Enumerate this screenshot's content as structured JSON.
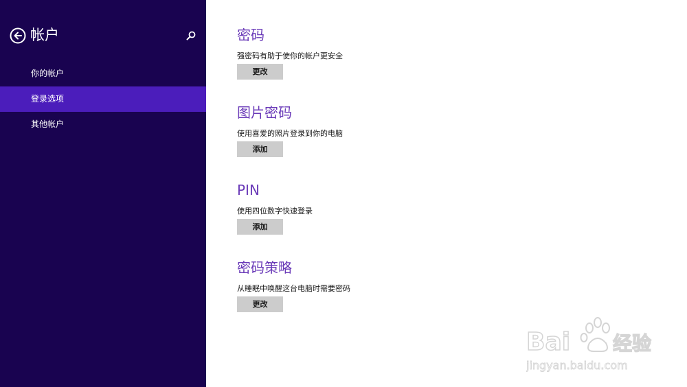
{
  "sidebar": {
    "title": "帐户",
    "back_icon": "back-arrow-circle-icon",
    "search_icon": "search-icon",
    "background": "#190350",
    "selected_color": "#4b1dbb",
    "items": [
      {
        "label": "你的帐户",
        "selected": false
      },
      {
        "label": "登录选项",
        "selected": true
      },
      {
        "label": "其他帐户",
        "selected": false
      }
    ]
  },
  "main": {
    "accent_color": "#6a3ab8",
    "sections": [
      {
        "title": "密码",
        "description": "强密码有助于使你的帐户更安全",
        "button_label": "更改"
      },
      {
        "title": "图片密码",
        "description": "使用喜爱的照片登录到你的电脑",
        "button_label": "添加"
      },
      {
        "title": "PIN",
        "description": "使用四位数字快速登录",
        "button_label": "添加"
      },
      {
        "title": "密码策略",
        "description": "从睡眠中唤醒这台电脑时需要密码",
        "button_label": "更改"
      }
    ]
  },
  "watermark": {
    "brand": "Baidu经验",
    "url": "jingyan.baidu.com"
  }
}
